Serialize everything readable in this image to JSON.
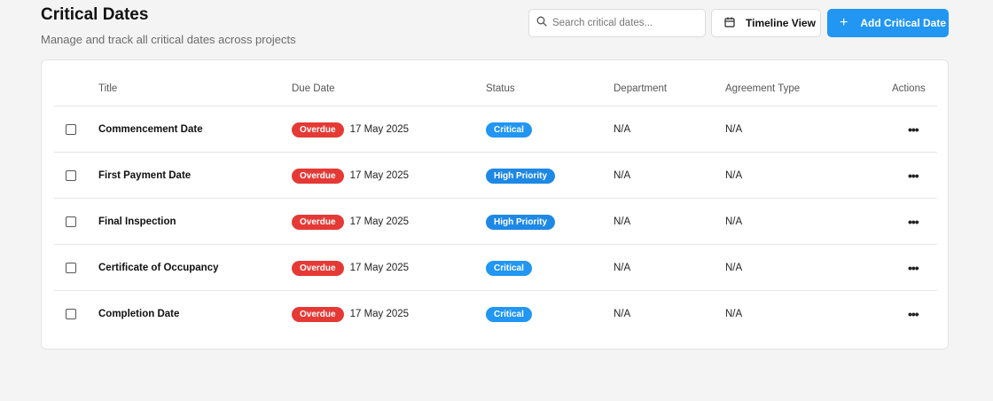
{
  "header": {
    "title": "Critical Dates",
    "subtitle": "Manage and track all critical dates across projects"
  },
  "toolbar": {
    "search_placeholder": "Search critical dates...",
    "timeline_label": "Timeline View",
    "add_label": "Add Critical Date",
    "add_plus": "+"
  },
  "table": {
    "columns": {
      "title": "Title",
      "due_date": "Due Date",
      "status": "Status",
      "department": "Department",
      "agreement_type": "Agreement Type",
      "actions": "Actions"
    },
    "rows": [
      {
        "title": "Commencement Date",
        "overdue": "Overdue",
        "due_date": "17 May 2025",
        "status": "Critical",
        "department": "N/A",
        "agreement_type": "N/A",
        "actions": "•••"
      },
      {
        "title": "First Payment Date",
        "overdue": "Overdue",
        "due_date": "17 May 2025",
        "status": "High Priority",
        "department": "N/A",
        "agreement_type": "N/A",
        "actions": "•••"
      },
      {
        "title": "Final Inspection",
        "overdue": "Overdue",
        "due_date": "17 May 2025",
        "status": "High Priority",
        "department": "N/A",
        "agreement_type": "N/A",
        "actions": "•••"
      },
      {
        "title": "Certificate of Occupancy",
        "overdue": "Overdue",
        "due_date": "17 May 2025",
        "status": "Critical",
        "department": "N/A",
        "agreement_type": "N/A",
        "actions": "•••"
      },
      {
        "title": "Completion Date",
        "overdue": "Overdue",
        "due_date": "17 May 2025",
        "status": "Critical",
        "department": "N/A",
        "agreement_type": "N/A",
        "actions": "•••"
      }
    ]
  },
  "colors": {
    "accent": "#2196f3",
    "overdue": "#e53935",
    "critical": "#2196f3",
    "high_priority": "#1e88e5"
  },
  "icons": {
    "search": "search-icon",
    "calendar": "calendar-icon",
    "plus": "plus-icon",
    "more": "more-horizontal-icon"
  }
}
